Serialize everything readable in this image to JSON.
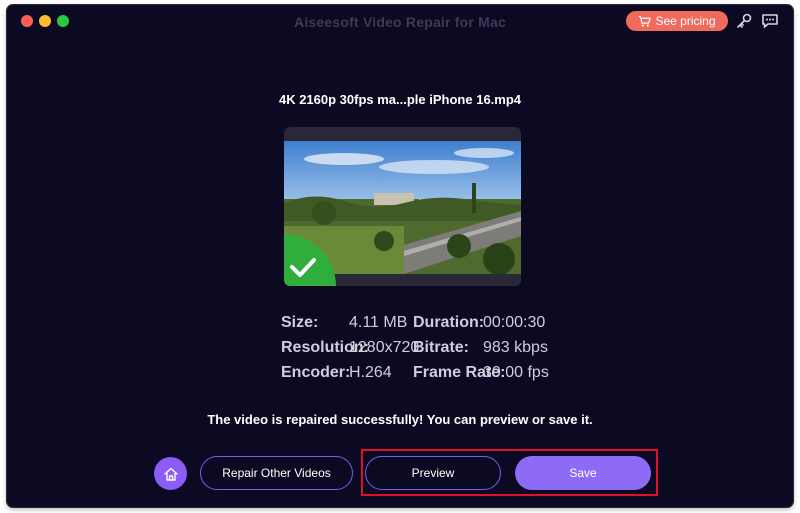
{
  "window": {
    "title": "Aiseesoft Video Repair for Mac",
    "pricing_label": "See pricing"
  },
  "video": {
    "filename": "4K 2160p 30fps ma...ple iPhone 16.mp4"
  },
  "info": {
    "size_label": "Size:",
    "size_value": "4.11 MB",
    "duration_label": "Duration:",
    "duration_value": "00:00:30",
    "resolution_label": "Resolution:",
    "resolution_value": "1280x720",
    "bitrate_label": "Bitrate:",
    "bitrate_value": "983 kbps",
    "encoder_label": "Encoder:",
    "encoder_value": "H.264",
    "framerate_label": "Frame Rate:",
    "framerate_value": "30.00 fps"
  },
  "status": {
    "message": "The video is repaired successfully! You can preview or save it."
  },
  "actions": {
    "repair_other_label": "Repair Other Videos",
    "preview_label": "Preview",
    "save_label": "Save"
  },
  "icons": {
    "pricing": "cart-icon",
    "key": "key-icon",
    "chat": "chat-icon",
    "home": "home-icon",
    "check": "checkmark-icon"
  },
  "colors": {
    "background": "#0c0a22",
    "accent": "#8e6bf5",
    "pricing": "#f06a5e",
    "highlight": "#e0102a",
    "success_badge": "#2fae3c"
  }
}
